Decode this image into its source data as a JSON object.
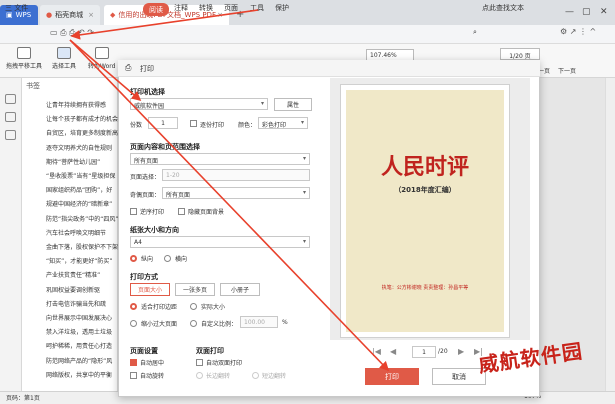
{
  "tabs": [
    {
      "label": "WPS"
    },
    {
      "label": "稻壳商城"
    },
    {
      "label": "信用的出现PDF文档_WPS PDF"
    }
  ],
  "menu": {
    "file": "三 文件",
    "items": [
      "阅读",
      "注释",
      "转换",
      "页面",
      "工具",
      "保护"
    ],
    "active_index": 0,
    "search": "点此查找文本"
  },
  "toolbar": {
    "hand": "拖拽平移工具",
    "select": "选择工具",
    "toword": "转为Word",
    "zoom": "107.46%",
    "page": "1/20 页",
    "prev": "上一页",
    "next": "下一页"
  },
  "bookmarks": {
    "title": "书签",
    "items": [
      "让青年持续拥有获得感",
      "让每个孩子都有成才的机会",
      "自贸区，培育更多制度新高",
      "逐夺文明养犬的自性规则",
      "期待“菩萨性幼儿园”",
      "“垦收股票”当有“星级担保",
      "国家组织药品“团购”，好",
      "规避中国经济的“暗新章”",
      "防范“指尖政务”中的“四风”",
      "汽车社会呼唤文明细节",
      "金曲下落，股权保护不下架",
      "“知买”，才能更好“防买”",
      "产业扶贫责任“精准”",
      "巩固权益要调创新驱",
      "打击电信诈骗当先和疏",
      "向世界展示中国发展决心",
      "禁入洋垃圾，透用土垃圾",
      "呵护稀稀，用责任心打造",
      "防范网络产品的“隐形”风",
      "网络版权，共享中的平衡"
    ]
  },
  "status": {
    "page": "页码：第1页",
    "zoom": "107%"
  },
  "dialog": {
    "title": "打印",
    "printer_section": "打印机选择",
    "printer": "威航软件园",
    "properties": "属性",
    "copies_label": "份数",
    "copies": "1",
    "collate": "逐份打印",
    "color_label": "颜色：",
    "color": "彩色打印",
    "range_section": "页面内容和页范围选择",
    "range": "所有页面",
    "page_select_label": "页面选择：",
    "page_select": "1-20",
    "odd_even_label": "奇偶页面：",
    "odd_even": "所有页面",
    "reverse": "逆序打印",
    "hide_bg": "隐藏页面背景",
    "paper_section": "纸张大小和方向",
    "paper": "A4",
    "portrait": "纵向",
    "landscape": "横向",
    "mode_section": "打印方式",
    "modes": [
      "页面大小",
      "一张多页",
      "小册子"
    ],
    "fit": "适合打印边距",
    "actual": "实际大小",
    "shrink": "缩小过大页面",
    "custom": "自定义比例：",
    "custom_value": "100.00",
    "percent": "%",
    "page_settings": "页面设置",
    "auto_center": "自动居中",
    "auto_rotate": "自动旋转",
    "duplex_section": "双面打印",
    "auto_duplex": "自动双面打印",
    "long_edge": "长边翻转",
    "short_edge": "短边翻转",
    "preview_title": "人民时评",
    "preview_subtitle": "（2018年度汇编）",
    "preview_foot": "执笔：公方彬谢晓    责责整理：孙昌平等",
    "nav_page": "1",
    "nav_total": "/20",
    "print": "打印",
    "cancel": "取消"
  },
  "watermark": "威航软件园",
  "colors": {
    "accent": "#e05a47",
    "title_red": "#c0231e",
    "arrow": "#e8412c"
  }
}
